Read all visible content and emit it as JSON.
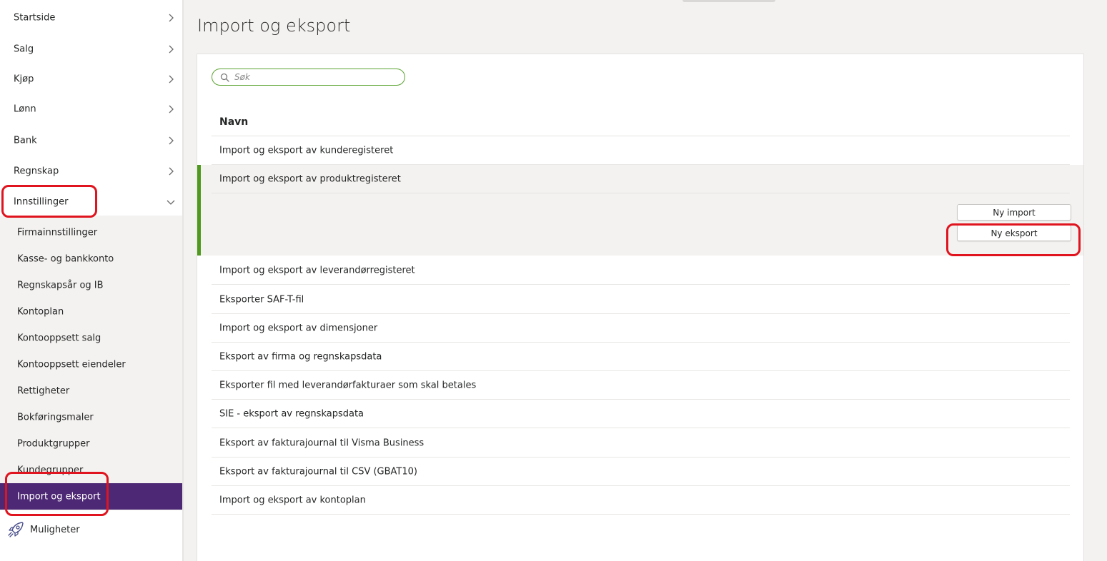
{
  "sidebar": {
    "main_items": [
      {
        "label": "Startside"
      },
      {
        "label": "Salg"
      },
      {
        "label": "Kjøp"
      },
      {
        "label": "Lønn"
      },
      {
        "label": "Bank"
      },
      {
        "label": "Regnskap"
      },
      {
        "label": "Innstillinger",
        "expanded": true
      }
    ],
    "sub_items": [
      {
        "label": "Firmainnstillinger"
      },
      {
        "label": "Kasse- og bankkonto"
      },
      {
        "label": "Regnskapsår og IB"
      },
      {
        "label": "Kontoplan"
      },
      {
        "label": "Kontooppsett salg"
      },
      {
        "label": "Kontooppsett eiendeler"
      },
      {
        "label": "Rettigheter"
      },
      {
        "label": "Bokføringsmaler"
      },
      {
        "label": "Produktgrupper"
      },
      {
        "label": "Kundegrupper"
      },
      {
        "label": "Import og eksport",
        "active": true
      }
    ],
    "opportunities": {
      "label": "Muligheter",
      "icon": "rocket-icon"
    }
  },
  "main": {
    "title": "Import og eksport",
    "search": {
      "placeholder": "Søk",
      "value": "",
      "icon": "search-icon"
    },
    "table": {
      "column_header": "Navn",
      "rows": [
        {
          "label": "Import og eksport av kunderegisteret"
        },
        {
          "label": "Import og eksport av produktregisteret",
          "expanded": true,
          "actions": [
            {
              "label": "Ny import"
            },
            {
              "label": "Ny eksport"
            }
          ]
        },
        {
          "label": "Import og eksport av leverandørregisteret"
        },
        {
          "label": "Eksporter SAF-T-fil"
        },
        {
          "label": "Import og eksport av dimensjoner"
        },
        {
          "label": "Eksport av firma og regnskapsdata"
        },
        {
          "label": "Eksporter fil med leverandørfakturaer som skal betales"
        },
        {
          "label": "SIE - eksport av regnskapsdata"
        },
        {
          "label": "Eksport av fakturajournal til Visma Business"
        },
        {
          "label": "Eksport av fakturajournal til CSV (GBAT10)"
        },
        {
          "label": "Import og eksport av kontoplan"
        }
      ]
    }
  },
  "colors": {
    "accent_purple": "#4d2874",
    "accent_green": "#4f9a1e",
    "highlight_red": "#e0141e"
  }
}
